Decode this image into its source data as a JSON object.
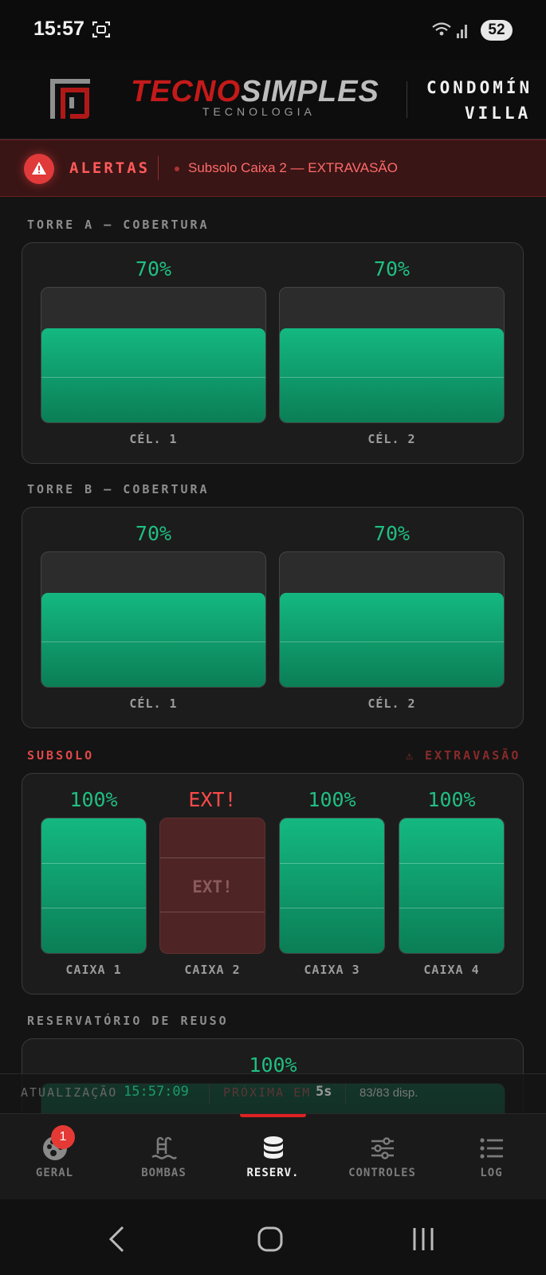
{
  "status_bar": {
    "time": "15:57",
    "battery": "52"
  },
  "header": {
    "brand_part1": "TECNO",
    "brand_part2": "SIMPLES",
    "brand_sub": "TECNOLOGIA",
    "condo_line1": "CONDOMÍN",
    "condo_line2": "VILLA"
  },
  "alerts": {
    "label": "ALERTAS",
    "message": "Subsolo Caixa 2 — EXTRAVASÃO"
  },
  "torre_a": {
    "title": "TORRE A — COBERTURA",
    "tanks": [
      {
        "label": "CÉL. 1",
        "pct_text": "70%",
        "level": 0.7
      },
      {
        "label": "CÉL. 2",
        "pct_text": "70%",
        "level": 0.7
      }
    ]
  },
  "torre_b": {
    "title": "TORRE B — COBERTURA",
    "tanks": [
      {
        "label": "CÉL. 1",
        "pct_text": "70%",
        "level": 0.7
      },
      {
        "label": "CÉL. 2",
        "pct_text": "70%",
        "level": 0.7
      }
    ]
  },
  "subsolo": {
    "title": "SUBSOLO",
    "flag": "⚠ EXTRAVASÃO",
    "tanks": [
      {
        "label": "CAIXA 1",
        "pct_text": "100%",
        "level": 1.0
      },
      {
        "label": "CAIXA 2",
        "pct_text": "EXT!",
        "inner_text": "EXT!",
        "state": "overflow"
      },
      {
        "label": "CAIXA 3",
        "pct_text": "100%",
        "level": 1.0
      },
      {
        "label": "CAIXA 4",
        "pct_text": "100%",
        "level": 1.0
      }
    ]
  },
  "reuso": {
    "title": "RESERVATÓRIO DE REUSO",
    "pct_text": "100%",
    "level": 1.0
  },
  "info_bar": {
    "update_label": "ATUALIZAÇÃO",
    "update_time": "15:57:09",
    "next_label": "PRÓXIMA EM",
    "next_value": "5s",
    "devices": "83/83 disp."
  },
  "nav": {
    "items": [
      {
        "label": "GERAL",
        "badge": "1"
      },
      {
        "label": "BOMBAS"
      },
      {
        "label": "RESERV."
      },
      {
        "label": "CONTROLES"
      },
      {
        "label": "LOG"
      }
    ],
    "active_index": 2
  },
  "colors": {
    "accent_green": "#1fbf82",
    "alert_red": "#e03a3a",
    "brand_red": "#c41a1a"
  },
  "icons": [
    "qr-scan-icon",
    "wifi-icon",
    "signal-icon",
    "tecnosimples-logo",
    "warning-icon",
    "dashboard-icon",
    "pool-pump-icon",
    "database-icon",
    "sliders-icon",
    "list-icon",
    "back-icon",
    "home-icon",
    "recents-icon"
  ]
}
